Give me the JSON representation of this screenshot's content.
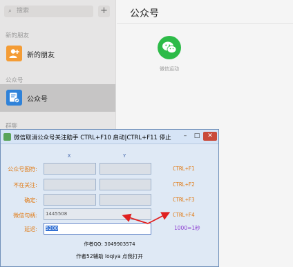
{
  "sidebar": {
    "search_placeholder": "搜索",
    "add_button": "+",
    "section_new_friends": "新的朋友",
    "item_new_friends": "新的朋友",
    "section_official": "公众号",
    "item_official": "公众号",
    "section_bottom": "群聊"
  },
  "main": {
    "title": "公众号",
    "account_name": "微信运动"
  },
  "dialog": {
    "title": "微信取消公众号关注助手 CTRL+F10 启动|CTRL+F11 停止",
    "minimize": "–",
    "maximize": "□",
    "close": "✕",
    "col_x": "X",
    "col_y": "Y",
    "rows": [
      {
        "label": "公众号图符:",
        "hotkey": "CTRL+F1"
      },
      {
        "label": "不在关注:",
        "hotkey": "CTRL+F2"
      },
      {
        "label": "确定:",
        "hotkey": "CTRL+F3"
      }
    ],
    "count_label": "微信句柄:",
    "count_value": "1445508",
    "count_hotkey": "CTRL+F4",
    "delay_label": "延迟:",
    "delay_value": "5200",
    "delay_hint": "1000=1秒",
    "author": "作者QQ: 3049903574",
    "open_link": "作者52辅助 loqiya 点我打开"
  },
  "colors": {
    "label_orange": "#e07a14",
    "hint_purple": "#8a3ad0",
    "arrow_red": "#e02020",
    "wechat_green": "#2dbb48"
  }
}
